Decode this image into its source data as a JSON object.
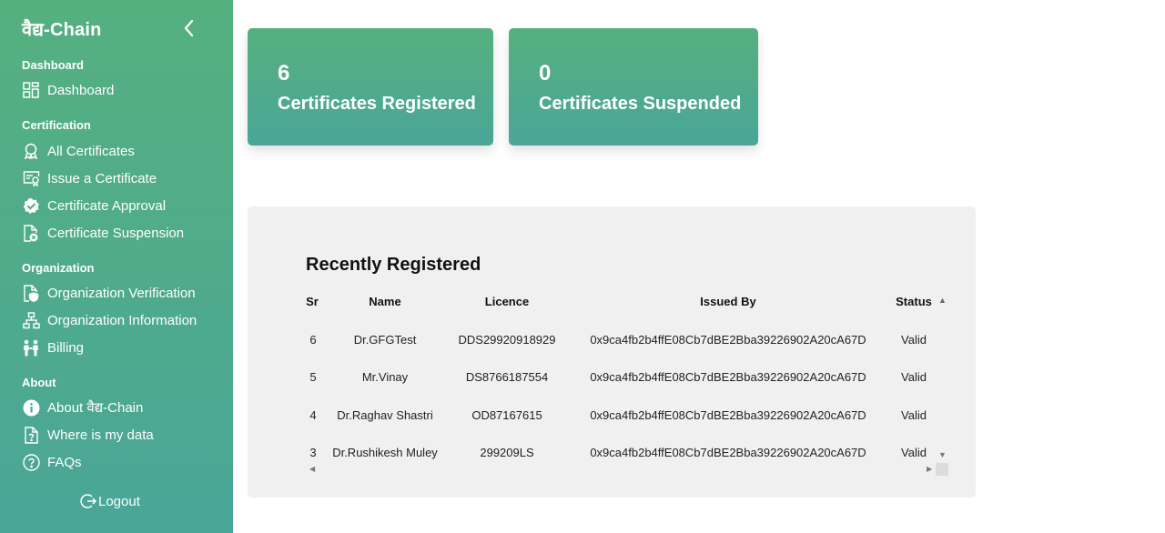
{
  "sidebar": {
    "brand": "वैद्य-Chain",
    "sections": {
      "dashboard": "Dashboard",
      "certification": "Certification",
      "organization": "Organization",
      "about": "About"
    },
    "items": {
      "dashboard": "Dashboard",
      "all_certificates": "All Certificates",
      "issue_certificate": "Issue a Certificate",
      "certificate_approval": "Certificate Approval",
      "certificate_suspension": "Certificate Suspension",
      "organization_verification": "Organization Verification",
      "organization_information": "Organization Information",
      "billing": "Billing",
      "about_chain": "About वैद्य-Chain",
      "where_data": "Where is my data",
      "faqs": "FAQs"
    },
    "logout": "Logout"
  },
  "cards": {
    "registered": {
      "value": "6",
      "label": "Certificates Registered"
    },
    "suspended": {
      "value": "0",
      "label": "Certificates Suspended"
    }
  },
  "table": {
    "title": "Recently Registered",
    "headers": {
      "sr": "Sr",
      "name": "Name",
      "licence": "Licence",
      "issued_by": "Issued By",
      "status": "Status"
    },
    "rows": [
      {
        "sr": "6",
        "name": "Dr.GFGTest",
        "licence": "DDS29920918929",
        "issued_by": "0x9ca4fb2b4ffE08Cb7dBE2Bba39226902A20cA67D",
        "status": "Valid"
      },
      {
        "sr": "5",
        "name": "Mr.Vinay",
        "licence": "DS8766187554",
        "issued_by": "0x9ca4fb2b4ffE08Cb7dBE2Bba39226902A20cA67D",
        "status": "Valid"
      },
      {
        "sr": "4",
        "name": "Dr.Raghav Shastri",
        "licence": "OD87167615",
        "issued_by": "0x9ca4fb2b4ffE08Cb7dBE2Bba39226902A20cA67D",
        "status": "Valid"
      },
      {
        "sr": "3",
        "name": "Dr.Rushikesh Muley",
        "licence": "299209LS",
        "issued_by": "0x9ca4fb2b4ffE08Cb7dBE2Bba39226902A20cA67D",
        "status": "Valid"
      }
    ]
  },
  "colors": {
    "accent_start": "#55b07f",
    "accent_end": "#4aa697",
    "panel": "#f0f0f0"
  },
  "icons": {
    "collapse": "chevron-left-icon",
    "dashboard": "grid-icon",
    "all_certificates": "award-icon",
    "issue_certificate": "certificate-icon",
    "certificate_approval": "badge-check-icon",
    "certificate_suspension": "file-x-icon",
    "organization_verification": "file-shield-icon",
    "organization_information": "org-chart-icon",
    "billing": "people-icon",
    "about_chain": "info-icon",
    "where_data": "file-question-icon",
    "faqs": "question-circle-icon",
    "logout": "logout-icon"
  }
}
